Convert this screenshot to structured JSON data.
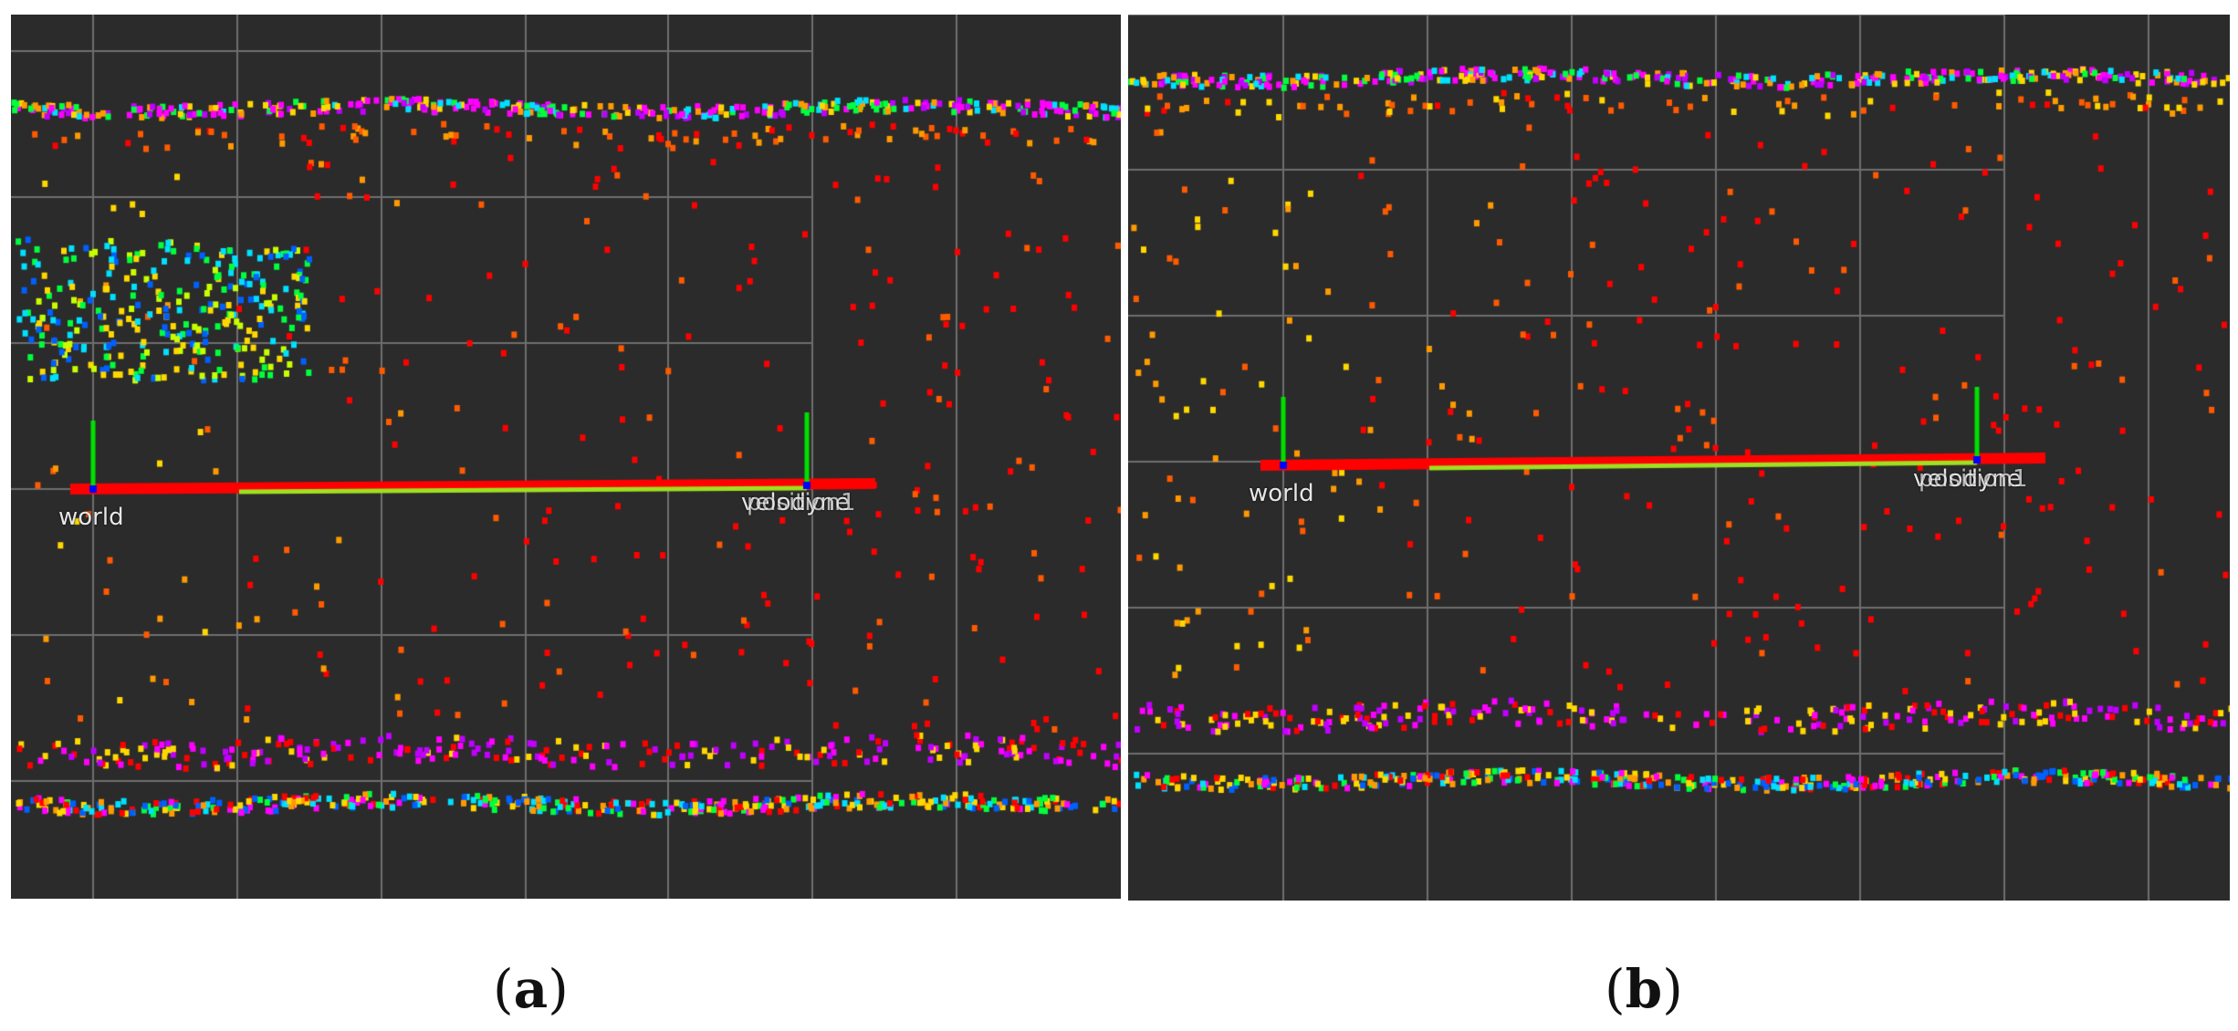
{
  "panels": [
    {
      "id": "a",
      "caption_letter": "a",
      "frames": {
        "origin": "world",
        "sensor_a": "velodyne",
        "sensor_b": "position1"
      }
    },
    {
      "id": "b",
      "caption_letter": "b",
      "frames": {
        "origin": "world",
        "sensor_a": "velodyne",
        "sensor_b": "position1"
      }
    }
  ],
  "colors": {
    "background": "#2b2b2b",
    "grid": "#6e6e6e",
    "x_axis": "#ff0000",
    "y_axis": "#00e000",
    "z_axis": "#0000ff",
    "point_palette": [
      "#ff0000",
      "#ff5a00",
      "#ff9a00",
      "#ffd800",
      "#c8ff00",
      "#00ff3c",
      "#00e0ff",
      "#0060ff",
      "#ff00ff",
      "#c000ff"
    ]
  }
}
